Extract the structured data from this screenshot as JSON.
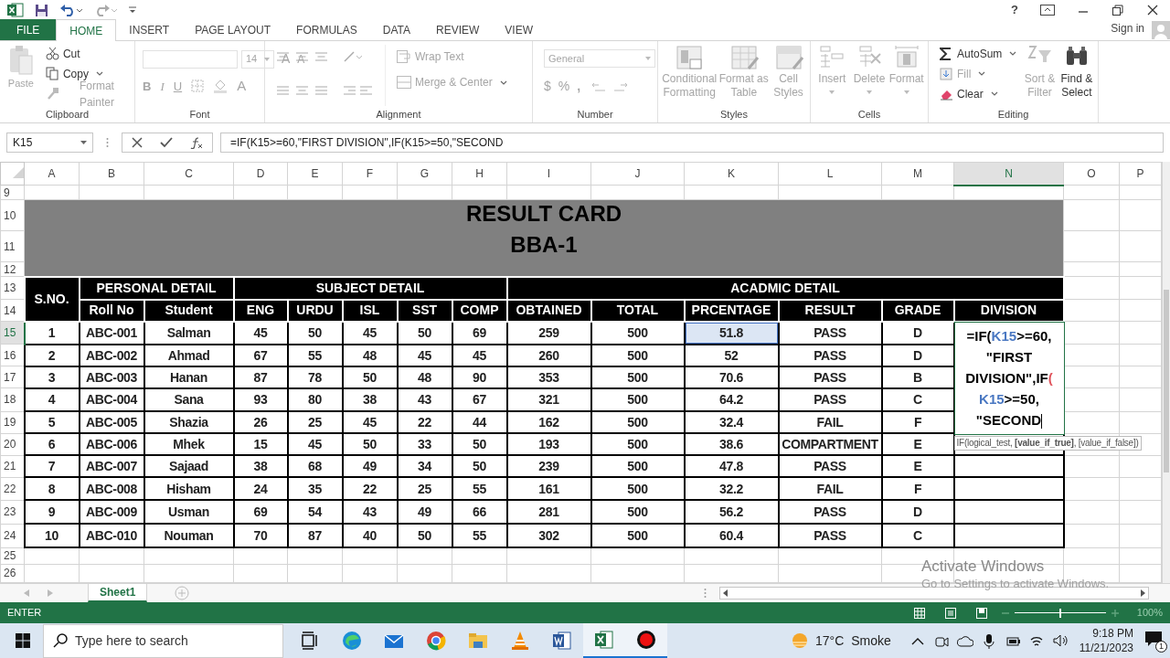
{
  "title_bar": {
    "help": "?",
    "sign_in": "Sign in"
  },
  "ribbon_tabs": [
    {
      "label": "FILE",
      "kind": "file",
      "selected": false
    },
    {
      "label": "HOME",
      "kind": "tab",
      "selected": true
    },
    {
      "label": "INSERT",
      "kind": "tab",
      "selected": false
    },
    {
      "label": "PAGE LAYOUT",
      "kind": "tab",
      "selected": false
    },
    {
      "label": "FORMULAS",
      "kind": "tab",
      "selected": false
    },
    {
      "label": "DATA",
      "kind": "tab",
      "selected": false
    },
    {
      "label": "REVIEW",
      "kind": "tab",
      "selected": false
    },
    {
      "label": "VIEW",
      "kind": "tab",
      "selected": false
    }
  ],
  "clipboard": {
    "label": "Clipboard",
    "paste": {
      "label": "Paste",
      "disabled": true
    },
    "commands": [
      {
        "label": "Cut",
        "disabled": false
      },
      {
        "label": "Copy",
        "disabled": false
      },
      {
        "label": "Format Painter",
        "disabled": true
      }
    ]
  },
  "font": {
    "label": "Font",
    "disabled": true,
    "font_size": "14",
    "grow": "A",
    "shrink": "A",
    "bold": "B",
    "italic": "I",
    "underline": "U",
    "font_color": "A"
  },
  "alignment": {
    "label": "Alignment",
    "disabled": true,
    "wrap_text": "Wrap Text",
    "merge_center": "Merge & Center"
  },
  "number": {
    "label": "Number",
    "disabled": true,
    "format": "General",
    "symbols": [
      "$",
      "%",
      ","
    ]
  },
  "styles": {
    "label": "Styles",
    "disabled": true,
    "commands": [
      "Conditional Formatting",
      "Format as Table",
      "Cell Styles"
    ]
  },
  "cells": {
    "label": "Cells",
    "disabled": true,
    "commands": [
      "Insert",
      "Delete",
      "Format"
    ]
  },
  "editing": {
    "label": "Editing",
    "commands": [
      {
        "label": "AutoSum",
        "disabled": false
      },
      {
        "label": "Fill",
        "disabled": true
      },
      {
        "label": "Clear",
        "disabled": false
      }
    ],
    "big_commands": [
      {
        "label": "Sort & Filter",
        "disabled": true
      },
      {
        "label": "Find & Select",
        "disabled": false
      }
    ]
  },
  "formula_bar": {
    "name_box": "K15",
    "formula": "=IF(K15>=60,\"FIRST DIVISION\",IF(K15>=50,\"SECOND"
  },
  "column_headers": [
    {
      "label": "A",
      "selected": false
    },
    {
      "label": "B",
      "selected": false
    },
    {
      "label": "C",
      "selected": false
    },
    {
      "label": "D",
      "selected": false
    },
    {
      "label": "E",
      "selected": false
    },
    {
      "label": "F",
      "selected": false
    },
    {
      "label": "G",
      "selected": false
    },
    {
      "label": "H",
      "selected": false
    },
    {
      "label": "I",
      "selected": false
    },
    {
      "label": "J",
      "selected": false
    },
    {
      "label": "K",
      "selected": false
    },
    {
      "label": "L",
      "selected": false
    },
    {
      "label": "M",
      "selected": false
    },
    {
      "label": "N",
      "selected": true
    },
    {
      "label": "O",
      "selected": false
    },
    {
      "label": "P",
      "selected": false
    }
  ],
  "row_headers": [
    {
      "label": "9",
      "selected": false
    },
    {
      "label": "10",
      "selected": false
    },
    {
      "label": "11",
      "selected": false
    },
    {
      "label": "12",
      "selected": false
    },
    {
      "label": "13",
      "selected": false
    },
    {
      "label": "14",
      "selected": false
    },
    {
      "label": "15",
      "selected": true
    },
    {
      "label": "16",
      "selected": false
    },
    {
      "label": "17",
      "selected": false
    },
    {
      "label": "18",
      "selected": false
    },
    {
      "label": "19",
      "selected": false
    },
    {
      "label": "20",
      "selected": false
    },
    {
      "label": "21",
      "selected": false
    },
    {
      "label": "22",
      "selected": false
    },
    {
      "label": "23",
      "selected": false
    },
    {
      "label": "24",
      "selected": false
    },
    {
      "label": "25",
      "selected": false
    },
    {
      "label": "26",
      "selected": false
    }
  ],
  "sheet": {
    "title": "RESULT CARD",
    "subtitle": "BBA-1",
    "sno_header": "S.NO.",
    "group_headers": [
      "PERSONAL DETAIL",
      "SUBJECT DETAIL",
      "ACADMIC DETAIL"
    ],
    "column_headings": [
      "Roll No",
      "Student",
      "ENG",
      "URDU",
      "ISL",
      "SST",
      "COMP",
      "OBTAINED",
      "TOTAL",
      "PRCENTAGE",
      "RESULT",
      "GRADE",
      "DIVISION"
    ],
    "rows": [
      {
        "referenced": true,
        "cells": [
          "1",
          "ABC-001",
          "Salman",
          "45",
          "50",
          "45",
          "50",
          "69",
          "259",
          "500",
          "51.8",
          "PASS",
          "D"
        ]
      },
      {
        "referenced": false,
        "cells": [
          "2",
          "ABC-002",
          "Ahmad",
          "67",
          "55",
          "48",
          "45",
          "45",
          "260",
          "500",
          "52",
          "PASS",
          "D"
        ]
      },
      {
        "referenced": false,
        "cells": [
          "3",
          "ABC-003",
          "Hanan",
          "87",
          "78",
          "50",
          "48",
          "90",
          "353",
          "500",
          "70.6",
          "PASS",
          "B"
        ]
      },
      {
        "referenced": false,
        "cells": [
          "4",
          "ABC-004",
          "Sana",
          "93",
          "80",
          "38",
          "43",
          "67",
          "321",
          "500",
          "64.2",
          "PASS",
          "C"
        ]
      },
      {
        "referenced": false,
        "cells": [
          "5",
          "ABC-005",
          "Shazia",
          "26",
          "25",
          "45",
          "22",
          "44",
          "162",
          "500",
          "32.4",
          "FAIL",
          "F"
        ]
      },
      {
        "referenced": false,
        "cells": [
          "6",
          "ABC-006",
          "Mhek",
          "15",
          "45",
          "50",
          "33",
          "50",
          "193",
          "500",
          "38.6",
          "COMPARTMENT",
          "E"
        ]
      },
      {
        "referenced": false,
        "cells": [
          "7",
          "ABC-007",
          "Sajaad",
          "38",
          "68",
          "49",
          "34",
          "50",
          "239",
          "500",
          "47.8",
          "PASS",
          "E"
        ]
      },
      {
        "referenced": false,
        "cells": [
          "8",
          "ABC-008",
          "Hisham",
          "24",
          "35",
          "22",
          "25",
          "55",
          "161",
          "500",
          "32.2",
          "FAIL",
          "F"
        ]
      },
      {
        "referenced": false,
        "cells": [
          "9",
          "ABC-009",
          "Usman",
          "69",
          "54",
          "43",
          "49",
          "66",
          "281",
          "500",
          "56.2",
          "PASS",
          "D"
        ]
      },
      {
        "referenced": false,
        "cells": [
          "10",
          "ABC-010",
          "Nouman",
          "70",
          "87",
          "40",
          "50",
          "55",
          "302",
          "500",
          "60.4",
          "PASS",
          "C"
        ]
      }
    ]
  },
  "editing_cell": {
    "segments": [
      {
        "text": "=IF(",
        "kind": "plain"
      },
      {
        "text": "K15",
        "kind": "reference"
      },
      {
        "text": ">=60, \"FIRST DIVISION\",IF",
        "kind": "plain"
      },
      {
        "text": "(",
        "kind": "paren"
      },
      {
        "text": " K15",
        "kind": "reference"
      },
      {
        "text": ">=50, \"SECOND",
        "kind": "plain"
      }
    ]
  },
  "function_tooltip": "IF(logical_test, **[value_if_true]**, [value_if_false])",
  "sheet_tabs": [
    {
      "label": "Sheet1",
      "selected": true
    }
  ],
  "status_bar": {
    "mode": "ENTER",
    "zoom": "100%",
    "zoom_slider": {
      "level": 0.5
    }
  },
  "activation_notice": {
    "title": "Activate Windows",
    "message": "Go to Settings to activate Windows."
  },
  "taskbar": {
    "search": {
      "placeholder": "Type here to search"
    },
    "temperature": "17°C",
    "weather": "Smoke",
    "time": "9:18 PM",
    "date": "11/21/2023",
    "notifications": "1"
  }
}
